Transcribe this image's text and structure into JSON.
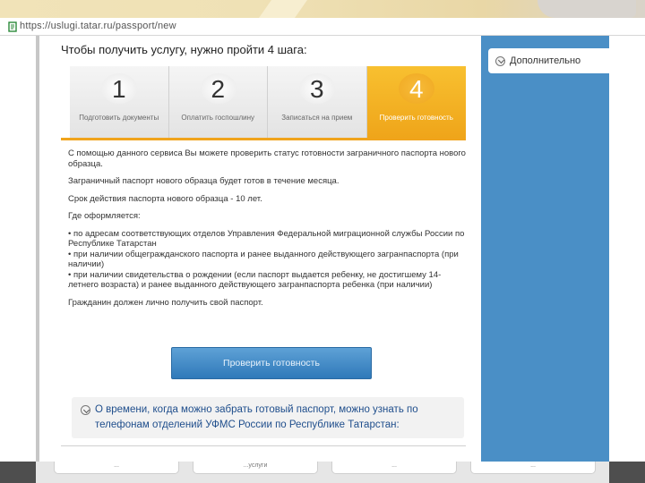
{
  "browser": {
    "url": "https://uslugi.tatar.ru/passport/new"
  },
  "page": {
    "headline": "Чтобы получить услугу, нужно пройти 4 шага:",
    "sidebar": {
      "more_label": "Дополнительно"
    },
    "steps": [
      {
        "num": "1",
        "label": "Подготовить документы"
      },
      {
        "num": "2",
        "label": "Оплатить госпошлину"
      },
      {
        "num": "3",
        "label": "Записаться на прием"
      },
      {
        "num": "4",
        "label": "Проверить готовность"
      }
    ],
    "content": {
      "p1": "С помощью данного сервиса Вы можете проверить статус готовности заграничного паспорта нового образца.",
      "p2": "Заграничный паспорт нового образца будет готов в течение месяца.",
      "p3": "Срок действия паспорта нового образца - 10 лет.",
      "p4": "Где оформляется:",
      "b1": "• по адресам соответствующих отделов Управления Федеральной миграционной службы России по Республике Татарстан",
      "b2": "• при наличии общегражданского паспорта и ранее выданного действующего загранпаспорта (при наличии)",
      "b3": "• при наличии свидетельства о рождении (если паспорт выдается ребенку, не достигшему 14-летнего возраста) и ранее выданного действующего загранпаспорта ребенка (при наличии)",
      "p5": "Гражданин должен лично получить свой паспорт."
    },
    "check_button": "Проверить готовность",
    "info_text": "О времени, когда можно забрать готовый паспорт, можно узнать по телефонам отделений УФМС России по Республике Татарстан:",
    "bottom_cards": [
      "...",
      "...услуги",
      "...",
      "..."
    ]
  },
  "colors": {
    "accent_orange": "#f0a41c",
    "sidebar_blue": "#4a8fc6",
    "link_blue": "#1f4e8c"
  }
}
